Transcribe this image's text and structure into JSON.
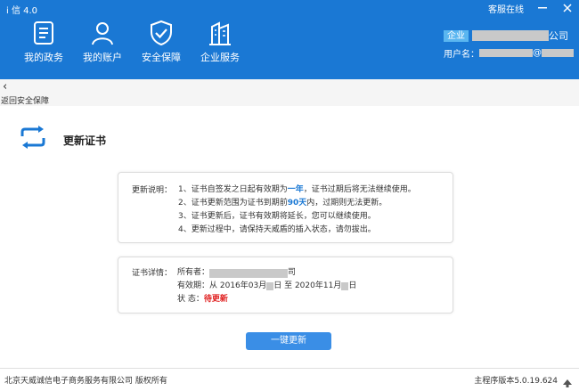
{
  "app": {
    "title": "i 信 4.0"
  },
  "topbar": {
    "support_label": "客服在线",
    "minimize_icon": "minimize-icon",
    "close_icon": "close-icon"
  },
  "nav": {
    "items": [
      {
        "label": "我的政务",
        "icon": "document-list-icon"
      },
      {
        "label": "我的账户",
        "icon": "user-icon"
      },
      {
        "label": "安全保障",
        "icon": "shield-check-icon"
      },
      {
        "label": "企业服务",
        "icon": "building-icon"
      }
    ]
  },
  "account": {
    "badge": "企业",
    "company_suffix": "公司",
    "username_label": "用户名：",
    "username_partial": "@"
  },
  "back": {
    "label": "返回安全保障"
  },
  "page": {
    "title": "更新证书",
    "icon": "refresh-icon"
  },
  "notes": {
    "label": "更新说明：",
    "items": [
      {
        "pre": "1、证书自签发之日起有效期为",
        "hl": "一年",
        "post": "，证书过期后将无法继续使用。"
      },
      {
        "pre": "2、证书更新范围为证书到期前",
        "hl": "90天",
        "post": "内，过期则无法更新。"
      },
      {
        "pre": "3、证书更新后，证书有效期将延长，您可以继续使用。",
        "hl": "",
        "post": ""
      },
      {
        "pre": "4、更新过程中，请保持天威盾的插入状态，请勿拔出。",
        "hl": "",
        "post": ""
      }
    ]
  },
  "cert": {
    "label": "证书详情：",
    "owner_label": "所有者：",
    "owner_suffix": "司",
    "validity_label": "有效期：从 2016年03月",
    "validity_mid1": "日 至 2020年11月",
    "validity_end": "日",
    "status_label": "状 态：",
    "status_value": "待更新"
  },
  "action": {
    "update_button": "一键更新"
  },
  "footer": {
    "copyright": "北京天威诚信电子商务服务有限公司 版权所有",
    "version": "主程序版本5.0.19.624",
    "up_icon": "arrow-up-icon"
  },
  "colors": {
    "primary": "#1a78d4",
    "accent_red": "#e02020",
    "button": "#3a8ee6"
  }
}
